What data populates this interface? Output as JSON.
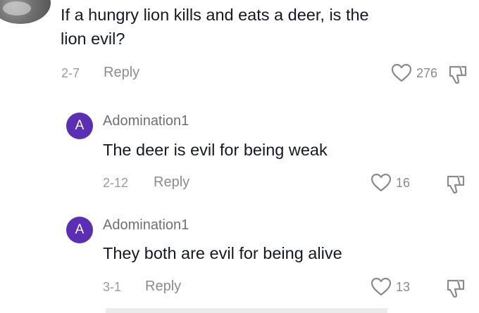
{
  "root_comment": {
    "text": "If a hungry lion kills and eats a deer, is the\nlion evil?",
    "date": "2-7",
    "reply_label": "Reply",
    "likes": "276"
  },
  "replies": [
    {
      "avatar_letter": "A",
      "username": "Adomination1",
      "text": "The deer is evil for being weak",
      "date": "2-12",
      "reply_label": "Reply",
      "likes": "16"
    },
    {
      "avatar_letter": "A",
      "username": "Adomination1",
      "text": "They both are evil for being alive",
      "date": "3-1",
      "reply_label": "Reply",
      "likes": "13"
    }
  ],
  "colors": {
    "avatar_bg": "#5b2fb3",
    "text_primary": "#161823",
    "text_secondary": "#8a8b91"
  },
  "icons": {
    "like": "heart-outline-icon",
    "dislike": "thumbs-down-outline-icon"
  }
}
